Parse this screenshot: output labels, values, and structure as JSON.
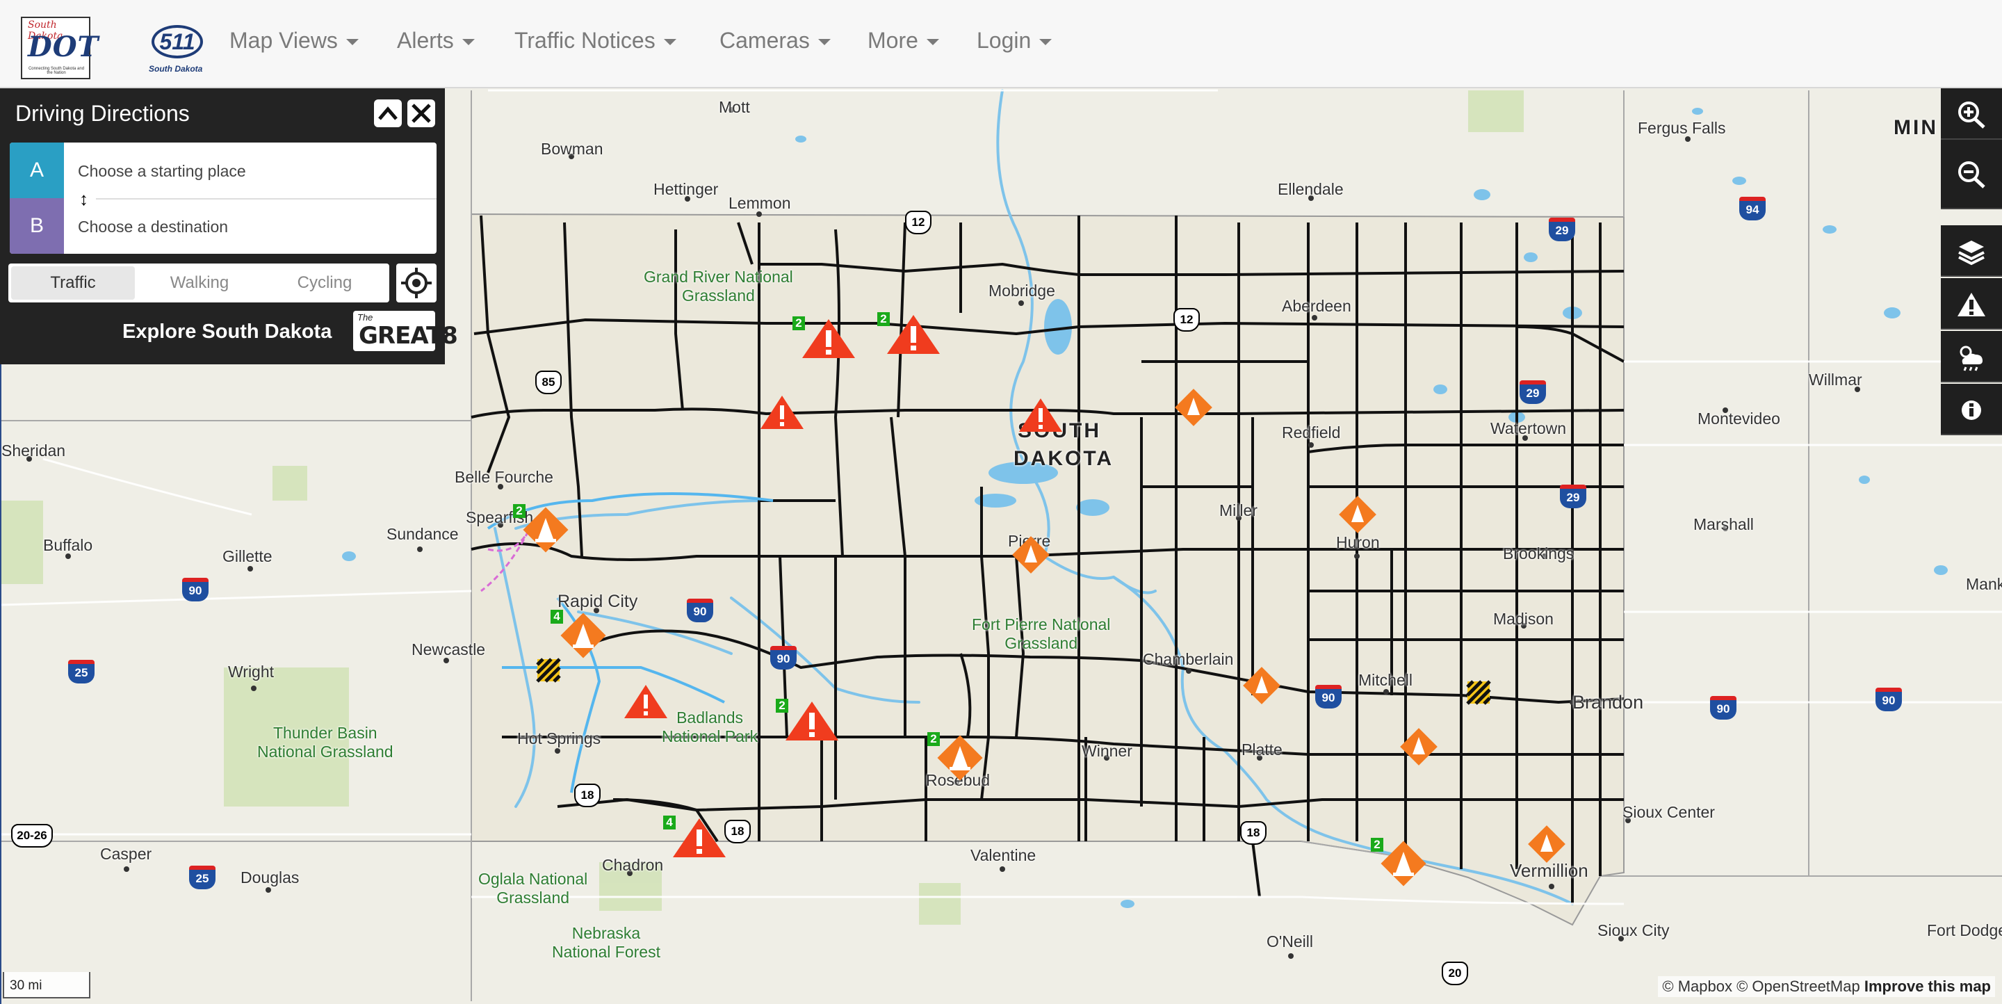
{
  "nav": {
    "logo_dot": {
      "state_script": "South Dakota",
      "letters": "DOT",
      "tagline": "Connecting South Dakota and the Nation"
    },
    "logo_511": {
      "number": "511",
      "state": "South Dakota"
    },
    "items": [
      {
        "label": "Map Views"
      },
      {
        "label": "Alerts"
      },
      {
        "label": "Traffic Notices"
      },
      {
        "label": "Cameras"
      },
      {
        "label": "More"
      },
      {
        "label": "Login"
      }
    ]
  },
  "directions": {
    "title": "Driving Directions",
    "start": {
      "badge": "A",
      "placeholder": "Choose a starting place",
      "value": ""
    },
    "dest": {
      "badge": "B",
      "placeholder": "Choose a destination",
      "value": ""
    },
    "modes": [
      "Traffic",
      "Walking",
      "Cycling"
    ],
    "active_mode": "Traffic",
    "explore": "Explore South Dakota",
    "great8": {
      "the": "The",
      "text": "GREAT8"
    },
    "colors": {
      "badge_a": "#2a9fc4",
      "badge_b": "#7e6eb0"
    }
  },
  "map": {
    "state_label": [
      "SOUTH",
      "DAKOTA"
    ],
    "corner_label": "MIN",
    "cities": [
      "Mott",
      "Bowman",
      "Hettinger",
      "Lemmon",
      "Ellendale",
      "Fergus Falls",
      "Mobridge",
      "Aberdeen",
      "Sheridan",
      "Belle Fourche",
      "Spearfish",
      "Sundance",
      "Buffalo",
      "Gillette",
      "Rapid City",
      "Newcastle",
      "Wright",
      "Hot Springs",
      "Chadron",
      "Casper",
      "Douglas",
      "Valentine",
      "Winner",
      "Rosebud",
      "Pierre",
      "Chamberlain",
      "Mitchell",
      "Huron",
      "Miller",
      "Redfield",
      "Watertown",
      "Brookings",
      "Madison",
      "Marshall",
      "Montevideo",
      "Willmar",
      "Brandon",
      "Sioux Center",
      "Vermillion",
      "Sioux City",
      "O'Neill",
      "Platte",
      "Fort Dodge",
      "Mank"
    ],
    "parks": [
      {
        "name": "Grand River National",
        "name2": "Grassland"
      },
      {
        "name": "Fort Pierre National",
        "name2": "Grassland"
      },
      {
        "name": "Badlands",
        "name2": "National Park"
      },
      {
        "name": "Thunder Basin",
        "name2": "National Grassland"
      },
      {
        "name": "Oglala National",
        "name2": "Grassland"
      },
      {
        "name": "Nebraska",
        "name2": "National Forest"
      }
    ],
    "interstate_shields": [
      "94",
      "29",
      "29",
      "29",
      "90",
      "90",
      "90",
      "90",
      "90",
      "25",
      "25",
      "90"
    ],
    "us_shields": [
      "12",
      "12",
      "85",
      "18",
      "18",
      "18",
      "20",
      "20-26"
    ],
    "markers": [
      {
        "type": "alert",
        "count": "2"
      },
      {
        "type": "alert",
        "count": "2"
      },
      {
        "type": "alert",
        "count": ""
      },
      {
        "type": "alert",
        "count": ""
      },
      {
        "type": "alert",
        "count": ""
      },
      {
        "type": "alert",
        "count": "2"
      },
      {
        "type": "alert",
        "count": "4"
      },
      {
        "type": "construction",
        "count": "2"
      },
      {
        "type": "construction",
        "count": "4"
      },
      {
        "type": "construction",
        "count": ""
      },
      {
        "type": "construction",
        "count": ""
      },
      {
        "type": "construction",
        "count": ""
      },
      {
        "type": "construction",
        "count": ""
      },
      {
        "type": "construction",
        "count": "2"
      },
      {
        "type": "construction",
        "count": ""
      },
      {
        "type": "construction",
        "count": "2"
      },
      {
        "type": "construction",
        "count": ""
      },
      {
        "type": "closure",
        "count": ""
      },
      {
        "type": "closure",
        "count": ""
      }
    ],
    "colors": {
      "alert": "#f03c1e",
      "construction": "#f47a1f",
      "water": "#7ec3ea",
      "roads": "#111111",
      "state_fill": "#e9e6d9"
    }
  },
  "toolbar": [
    "zoom-in-icon",
    "zoom-out-icon",
    "layers-icon",
    "alert-triangle-icon",
    "weather-icon",
    "info-icon"
  ],
  "footer": {
    "scale": "30 mi",
    "attribution": "© Mapbox © OpenStreetMap",
    "improve": "Improve this map"
  }
}
